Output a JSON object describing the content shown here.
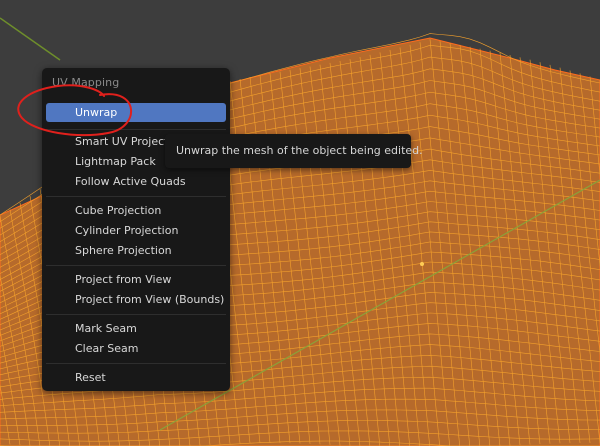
{
  "menu": {
    "title": "UV Mapping",
    "items": [
      {
        "label": "Unwrap",
        "active": true
      },
      {
        "label": "Smart UV Project"
      },
      {
        "label": "Lightmap Pack"
      },
      {
        "label": "Follow Active Quads"
      },
      {
        "label": "Cube Projection"
      },
      {
        "label": "Cylinder Projection"
      },
      {
        "label": "Sphere Projection"
      },
      {
        "label": "Project from View"
      },
      {
        "label": "Project from View (Bounds)"
      },
      {
        "label": "Mark Seam"
      },
      {
        "label": "Clear Seam"
      },
      {
        "label": "Reset"
      }
    ]
  },
  "tooltip": {
    "text": "Unwrap the mesh of the object being edited."
  },
  "colors": {
    "mesh_fill": "#b66a2b",
    "wireframe": "#f4a12c",
    "active_item": "#5077c1",
    "annotation": "#e0201c"
  }
}
